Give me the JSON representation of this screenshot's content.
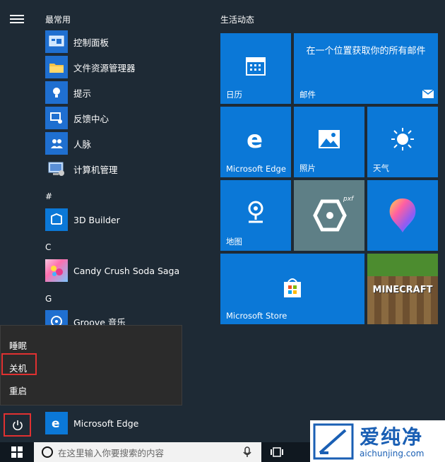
{
  "start_menu": {
    "most_used_label": "最常用",
    "most_used_items": [
      {
        "label": "控制面板",
        "icon": "control-panel-icon"
      },
      {
        "label": "文件资源管理器",
        "icon": "file-explorer-icon"
      },
      {
        "label": "提示",
        "icon": "tips-icon"
      },
      {
        "label": "反馈中心",
        "icon": "feedback-icon"
      },
      {
        "label": "人脉",
        "icon": "people-icon"
      },
      {
        "label": "计算机管理",
        "icon": "computer-management-icon"
      }
    ],
    "groups": [
      {
        "letter": "#",
        "items": [
          {
            "label": "3D Builder",
            "icon": "3d-builder-icon"
          }
        ]
      },
      {
        "letter": "C",
        "items": [
          {
            "label": "Candy Crush Soda Saga",
            "icon": "candy-crush-icon"
          }
        ]
      },
      {
        "letter": "G",
        "items": [
          {
            "label": "Groove 音乐",
            "icon": "groove-icon"
          }
        ]
      }
    ],
    "bottom_item": {
      "label": "Microsoft Edge",
      "icon": "edge-icon"
    }
  },
  "power_menu": {
    "items": [
      "睡眠",
      "关机",
      "重启"
    ],
    "highlighted": "关机"
  },
  "tiles": {
    "section_title": "生活动态",
    "items": [
      {
        "id": "calendar",
        "label": "日历",
        "icon": "calendar-icon"
      },
      {
        "id": "mail",
        "label": "邮件",
        "text": "在一个位置获取你的所有邮件",
        "icon": "mail-icon"
      },
      {
        "id": "edge",
        "label": "Microsoft Edge",
        "icon": "edge-icon"
      },
      {
        "id": "photos",
        "label": "照片",
        "icon": "photos-icon"
      },
      {
        "id": "weather",
        "label": "天气",
        "icon": "weather-icon"
      },
      {
        "id": "maps",
        "label": "地图",
        "icon": "maps-icon"
      },
      {
        "id": "pxf",
        "label": "",
        "icon": "pxf-icon",
        "text": "pxf"
      },
      {
        "id": "paint3d",
        "label": "",
        "icon": "paint3d-icon"
      },
      {
        "id": "store",
        "label": "Microsoft Store",
        "icon": "store-icon"
      },
      {
        "id": "minecraft",
        "label": "",
        "text": "MINECRAFT",
        "icon": "minecraft-icon"
      }
    ]
  },
  "taskbar": {
    "search_placeholder": "在这里输入你要搜索的内容"
  },
  "watermark": {
    "title": "爱纯净",
    "url": "aichunjing.com"
  },
  "colors": {
    "tile_blue": "#0b78d7",
    "background": "#1e2a35",
    "highlight_red": "#e03131"
  }
}
